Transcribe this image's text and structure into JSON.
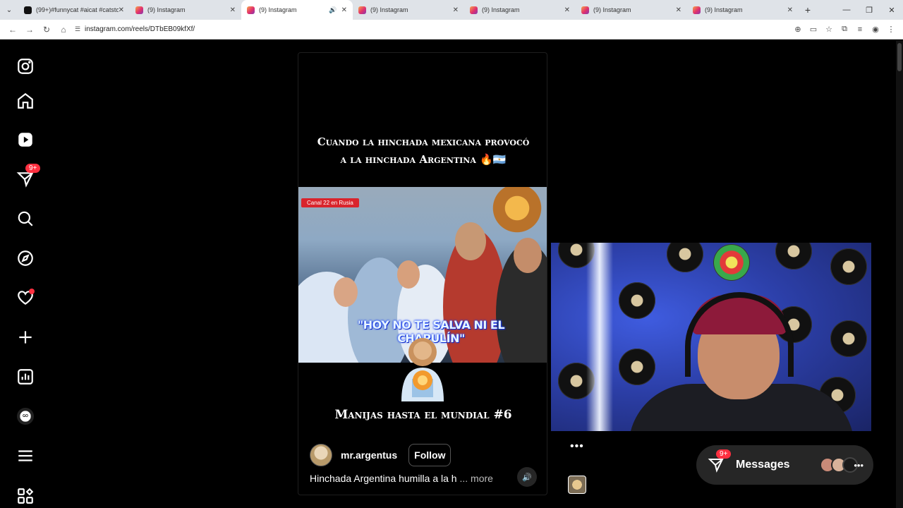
{
  "browser": {
    "tabs": [
      {
        "title": "(99+)#funnycat #aicat #catston",
        "favicon": "tiktok-icon",
        "active": false
      },
      {
        "title": "(9) Instagram",
        "favicon": "instagram-icon",
        "active": false
      },
      {
        "title": "(9) Instagram",
        "favicon": "instagram-icon",
        "active": true,
        "audio": true
      },
      {
        "title": "(9) Instagram",
        "favicon": "instagram-icon",
        "active": false
      },
      {
        "title": "(9) Instagram",
        "favicon": "instagram-icon",
        "active": false
      },
      {
        "title": "(9) Instagram",
        "favicon": "instagram-icon",
        "active": false
      },
      {
        "title": "(9) Instagram",
        "favicon": "instagram-icon",
        "active": false
      }
    ],
    "url": "instagram.com/reels/DTbEB09kfXf/"
  },
  "sidebar": {
    "notifications_badge": "9+",
    "items": [
      "instagram-logo",
      "home",
      "reels",
      "messages",
      "search",
      "explore",
      "notifications",
      "create",
      "dashboard",
      "profile",
      "more",
      "also-from-meta"
    ]
  },
  "reel": {
    "title_line1": "Cuando la hinchada mexicana provocó",
    "title_line2": "a la hinchada Argentina 🔥🇦🇷",
    "canal_tag": "Canal 22 en Rusia",
    "overlay_caption": "\"HOY NO TE SALVA NI EL CHAPULÍN\"",
    "subtitle": "Manijas hasta el mundial #6",
    "author": "mr.argentus",
    "follow_label": "Follow",
    "caption": "Hinchada Argentina humilla a la h",
    "more_label": "... more"
  },
  "messages": {
    "label": "Messages",
    "badge": "9+"
  },
  "colors": {
    "accent_red": "#ff3040",
    "background": "#000000",
    "pill": "#262626"
  }
}
